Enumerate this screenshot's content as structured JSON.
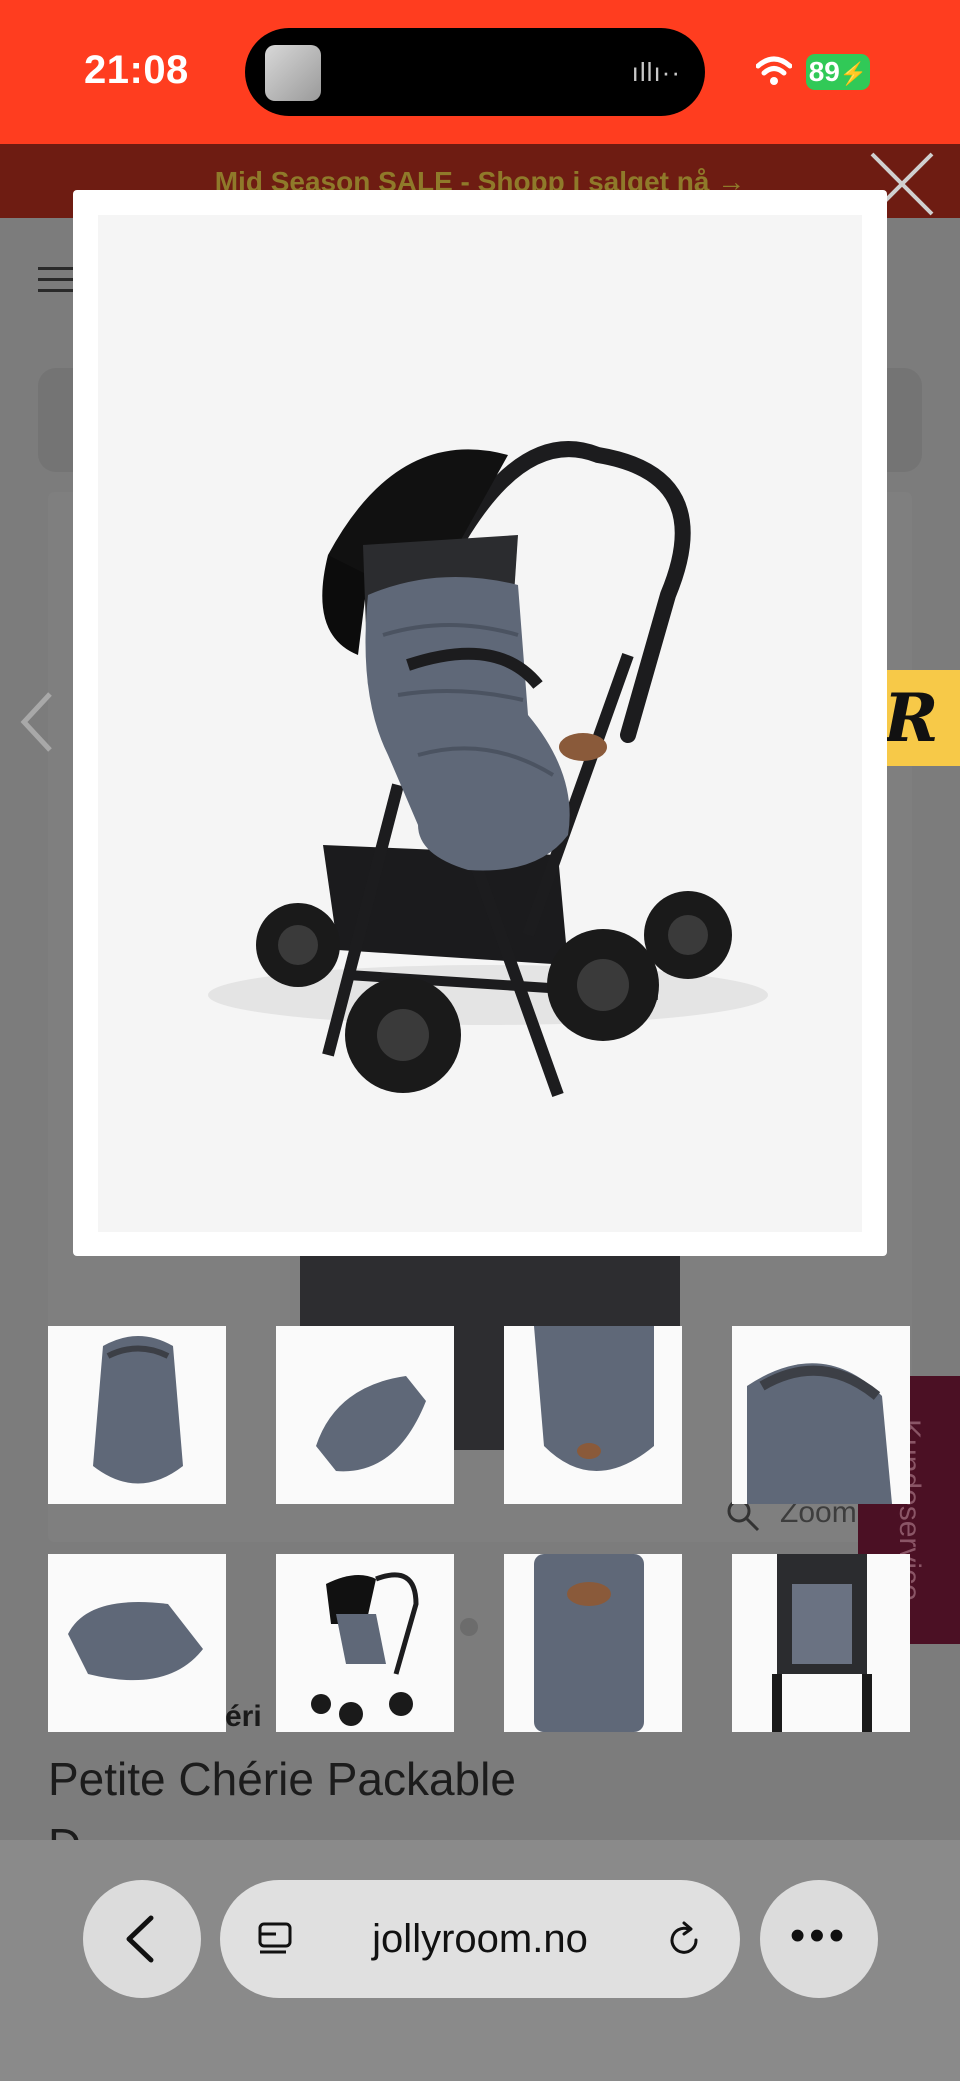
{
  "status_bar": {
    "time": "21:08",
    "battery": "89"
  },
  "banner": {
    "text": "Mid Season SALE - Shopp i salget nå →"
  },
  "page": {
    "zoom_label": "Zoom",
    "brand_fragment": "éri",
    "product_title_line1": "Petite Chérie Packable",
    "product_title_line2": "D",
    "side_tab_label": "Kundeservice",
    "r_badge": "R"
  },
  "lightbox": {
    "image_alt": "Stroller with grey footmuff",
    "thumbnails": [
      {
        "name": "footmuff-front"
      },
      {
        "name": "footmuff-side"
      },
      {
        "name": "footmuff-closeup"
      },
      {
        "name": "footmuff-hood"
      },
      {
        "name": "footmuff-flat"
      },
      {
        "name": "stroller-with-footmuff"
      },
      {
        "name": "footmuff-pack-bag"
      },
      {
        "name": "stroller-seat-view"
      }
    ]
  },
  "browser": {
    "url": "jollyroom.no"
  },
  "colors": {
    "status_bar": "#ff3d1f",
    "banner": "#6e1c12",
    "r_badge": "#f7c948",
    "side_tab": "#4b1024"
  }
}
